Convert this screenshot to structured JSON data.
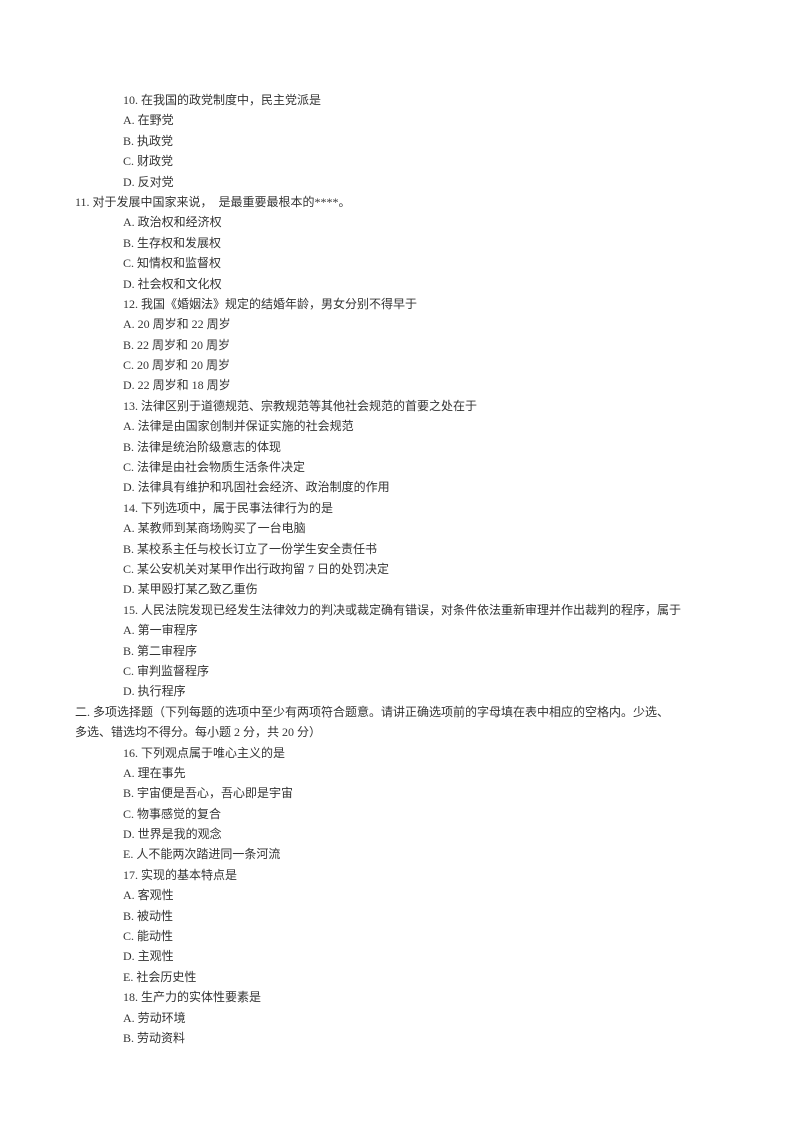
{
  "lines": [
    {
      "cls": "indent1",
      "text": "10. 在我国的政党制度中，民主党派是"
    },
    {
      "cls": "indent1",
      "text": "A. 在野党"
    },
    {
      "cls": "indent1",
      "text": "B. 执政党"
    },
    {
      "cls": "indent1",
      "text": "C. 财政党"
    },
    {
      "cls": "indent1",
      "text": "D. 反对党"
    },
    {
      "cls": "indent0",
      "text": "11. 对于发展中国家来说，  是最重要最根本的****。"
    },
    {
      "cls": "indent1",
      "text": "A. 政治权和经济权"
    },
    {
      "cls": "indent1",
      "text": "B. 生存权和发展权"
    },
    {
      "cls": "indent1",
      "text": "C. 知情权和监督权"
    },
    {
      "cls": "indent1",
      "text": "D. 社会权和文化权"
    },
    {
      "cls": "indent1",
      "text": "12. 我国《婚姻法》规定的结婚年龄，男女分别不得早于"
    },
    {
      "cls": "indent1",
      "text": "A. 20 周岁和 22 周岁"
    },
    {
      "cls": "indent1",
      "text": "B. 22 周岁和 20 周岁"
    },
    {
      "cls": "indent1",
      "text": "C. 20 周岁和 20 周岁"
    },
    {
      "cls": "indent1",
      "text": "D. 22 周岁和 18 周岁"
    },
    {
      "cls": "indent1",
      "text": "13. 法律区别于道德规范、宗教规范等其他社会规范的首要之处在于"
    },
    {
      "cls": "indent1",
      "text": "A. 法律是由国家创制并保证实施的社会规范"
    },
    {
      "cls": "indent1",
      "text": "B. 法律是统治阶级意志的体现"
    },
    {
      "cls": "indent1",
      "text": "C. 法律是由社会物质生活条件决定"
    },
    {
      "cls": "indent1",
      "text": "D. 法律具有维护和巩固社会经济、政治制度的作用"
    },
    {
      "cls": "indent1",
      "text": "14. 下列选项中，属于民事法律行为的是"
    },
    {
      "cls": "indent1",
      "text": "A. 某教师到某商场购买了一台电脑"
    },
    {
      "cls": "indent1",
      "text": "B. 某校系主任与校长订立了一份学生安全责任书"
    },
    {
      "cls": "indent1",
      "text": "C. 某公安机关对某甲作出行政拘留 7 日的处罚决定"
    },
    {
      "cls": "indent1",
      "text": "D. 某甲殴打某乙致乙重伤"
    },
    {
      "cls": "indent1",
      "text": "15. 人民法院发现已经发生法律效力的判决或裁定确有错误，对条件依法重新审理并作出裁判的程序，属于"
    },
    {
      "cls": "indent1",
      "text": "A. 第一审程序"
    },
    {
      "cls": "indent1",
      "text": "B. 第二审程序"
    },
    {
      "cls": "indent1",
      "text": "C. 审判监督程序"
    },
    {
      "cls": "indent1",
      "text": "D. 执行程序"
    },
    {
      "cls": "indent0",
      "text": "二. 多项选择题（下列每题的选项中至少有两项符合题意。请讲正确选项前的字母填在表中相应的空格内。少选、"
    },
    {
      "cls": "indent0",
      "text": "多选、错选均不得分。每小题 2 分，共 20 分）"
    },
    {
      "cls": "indent1",
      "text": "16. 下列观点属于唯心主义的是"
    },
    {
      "cls": "indent1",
      "text": "A. 理在事先"
    },
    {
      "cls": "indent1",
      "text": "B. 宇宙便是吾心，吾心即是宇宙"
    },
    {
      "cls": "indent1",
      "text": "C. 物事感觉的复合"
    },
    {
      "cls": "indent1",
      "text": "D. 世界是我的观念"
    },
    {
      "cls": "indent1",
      "text": "E. 人不能两次踏进同一条河流"
    },
    {
      "cls": "indent1",
      "text": "17. 实现的基本特点是"
    },
    {
      "cls": "indent1",
      "text": "A. 客观性"
    },
    {
      "cls": "indent1",
      "text": "B. 被动性"
    },
    {
      "cls": "indent1",
      "text": "C. 能动性"
    },
    {
      "cls": "indent1",
      "text": "D. 主观性"
    },
    {
      "cls": "indent1",
      "text": "E. 社会历史性"
    },
    {
      "cls": "indent1",
      "text": "18. 生产力的实体性要素是"
    },
    {
      "cls": "indent1",
      "text": "A. 劳动环境"
    },
    {
      "cls": "indent1",
      "text": "B. 劳动资料"
    }
  ]
}
